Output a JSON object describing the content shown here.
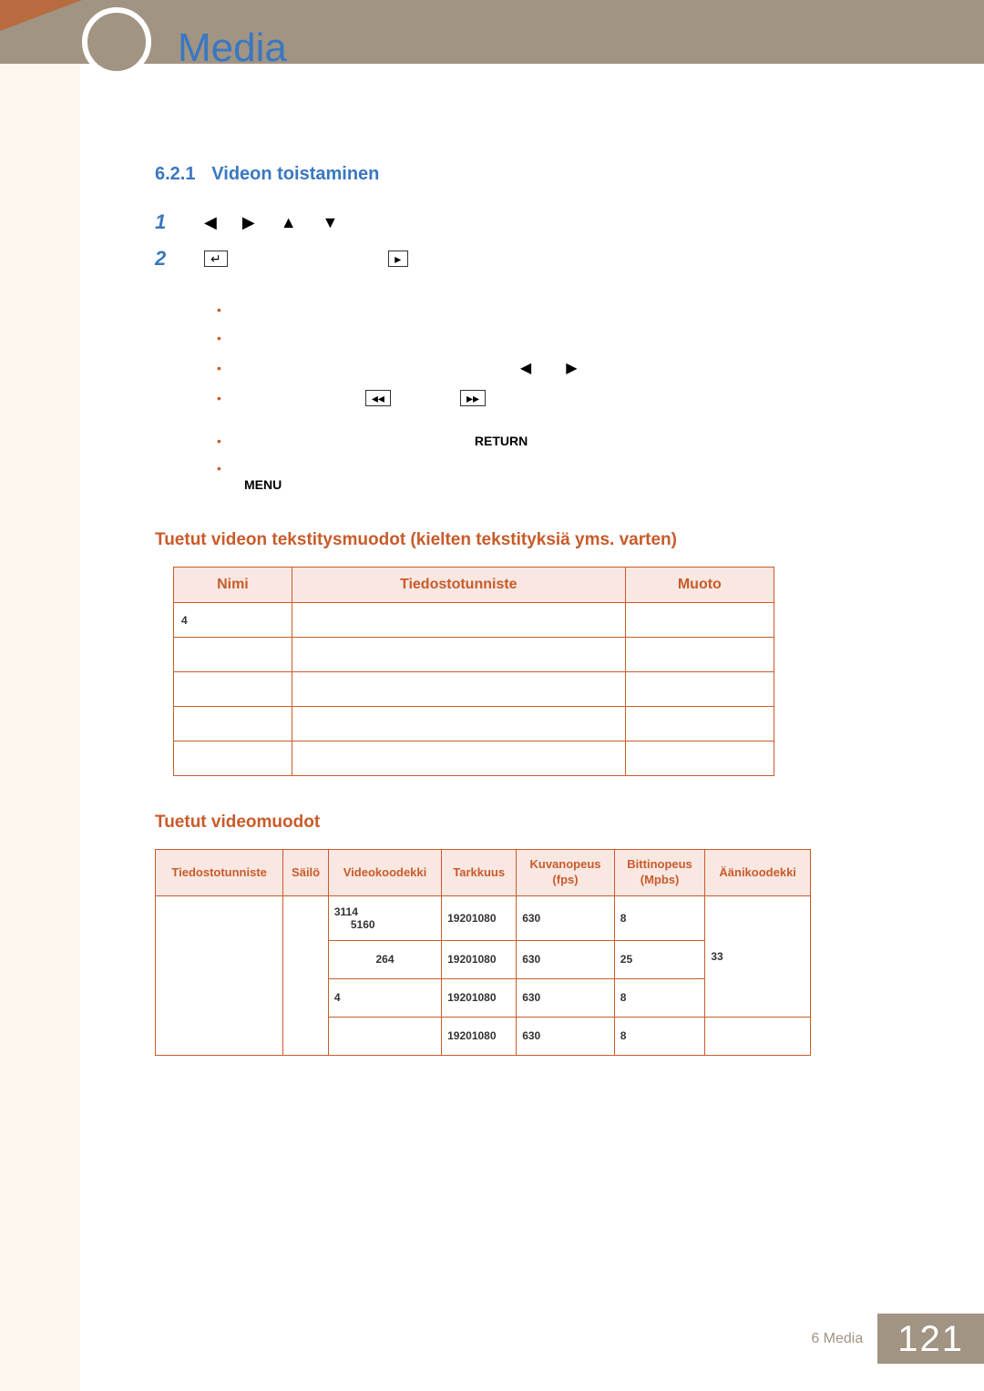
{
  "header": {
    "title": "Media"
  },
  "section": {
    "number": "6.2.1",
    "title": "Videon toistaminen"
  },
  "steps": {
    "s1": "1",
    "s2": "2"
  },
  "keywords": {
    "return": "RETURN",
    "menu": "MENU"
  },
  "subheads": {
    "subtitles": "Tuetut videon tekstitysmuodot (kielten tekstityksiä yms. varten)",
    "videofmt": "Tuetut videomuodot"
  },
  "t1": {
    "headers": {
      "c1": "Nimi",
      "c2": "Tiedostotunniste",
      "c3": "Muoto"
    },
    "rows": [
      {
        "c1": "4",
        "c2": "",
        "c3": ""
      },
      {
        "c1": "",
        "c2": "",
        "c3": ""
      },
      {
        "c1": "",
        "c2": "",
        "c3": ""
      },
      {
        "c1": "",
        "c2": "",
        "c3": ""
      },
      {
        "c1": "",
        "c2": "",
        "c3": ""
      }
    ]
  },
  "t2": {
    "headers": {
      "c1": "Tiedostotunniste",
      "c2": "Säilö",
      "c3": "Videokoodekki",
      "c4": "Tarkkuus",
      "c5a": "Kuvanopeus",
      "c5b": "(fps)",
      "c6a": "Bittinopeus",
      "c6b": "(Mpbs)",
      "c7": "Äänikoodekki"
    },
    "rows": [
      {
        "c3a": "3114",
        "c3b": "5160",
        "c4": "19201080",
        "c5": "630",
        "c6": "8",
        "c7": "33"
      },
      {
        "c3": "264",
        "c4": "19201080",
        "c5": "630",
        "c6": "25"
      },
      {
        "c3": "4",
        "c4": "19201080",
        "c5": "630",
        "c6": "8"
      },
      {
        "c4": "19201080",
        "c5": "630",
        "c6": "8"
      }
    ]
  },
  "footer": {
    "chapter": "6 Media",
    "page": "121"
  }
}
